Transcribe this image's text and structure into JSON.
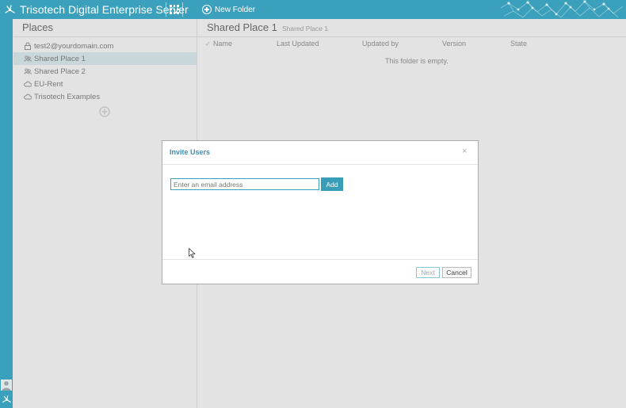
{
  "header": {
    "app_title": "Trisotech Digital Enterprise Server",
    "new_folder_label": "New Folder",
    "accent_color": "#3aa0bb"
  },
  "sidebar": {
    "title": "Places",
    "items": [
      {
        "label": "test2@yourdomain.com",
        "icon": "lock-icon",
        "selected": false
      },
      {
        "label": "Shared Place 1",
        "icon": "shared-place-icon",
        "selected": true
      },
      {
        "label": "Shared Place 2",
        "icon": "shared-place-icon",
        "selected": false
      },
      {
        "label": "EU-Rent",
        "icon": "cloud-icon",
        "selected": false
      },
      {
        "label": "Trisotech Examples",
        "icon": "cloud-icon",
        "selected": false
      }
    ],
    "add_icon": "plus-circle-icon"
  },
  "content": {
    "title": "Shared Place 1",
    "breadcrumb": "Shared Place 1",
    "columns": [
      "Name",
      "Last Updated",
      "Updated by",
      "Version",
      "State"
    ],
    "empty_message": "This folder is empty."
  },
  "dialog": {
    "title": "Invite Users",
    "email_placeholder": "Enter an email address",
    "email_value": "",
    "add_label": "Add",
    "next_label": "Next",
    "cancel_label": "Cancel",
    "close_glyph": "×"
  }
}
